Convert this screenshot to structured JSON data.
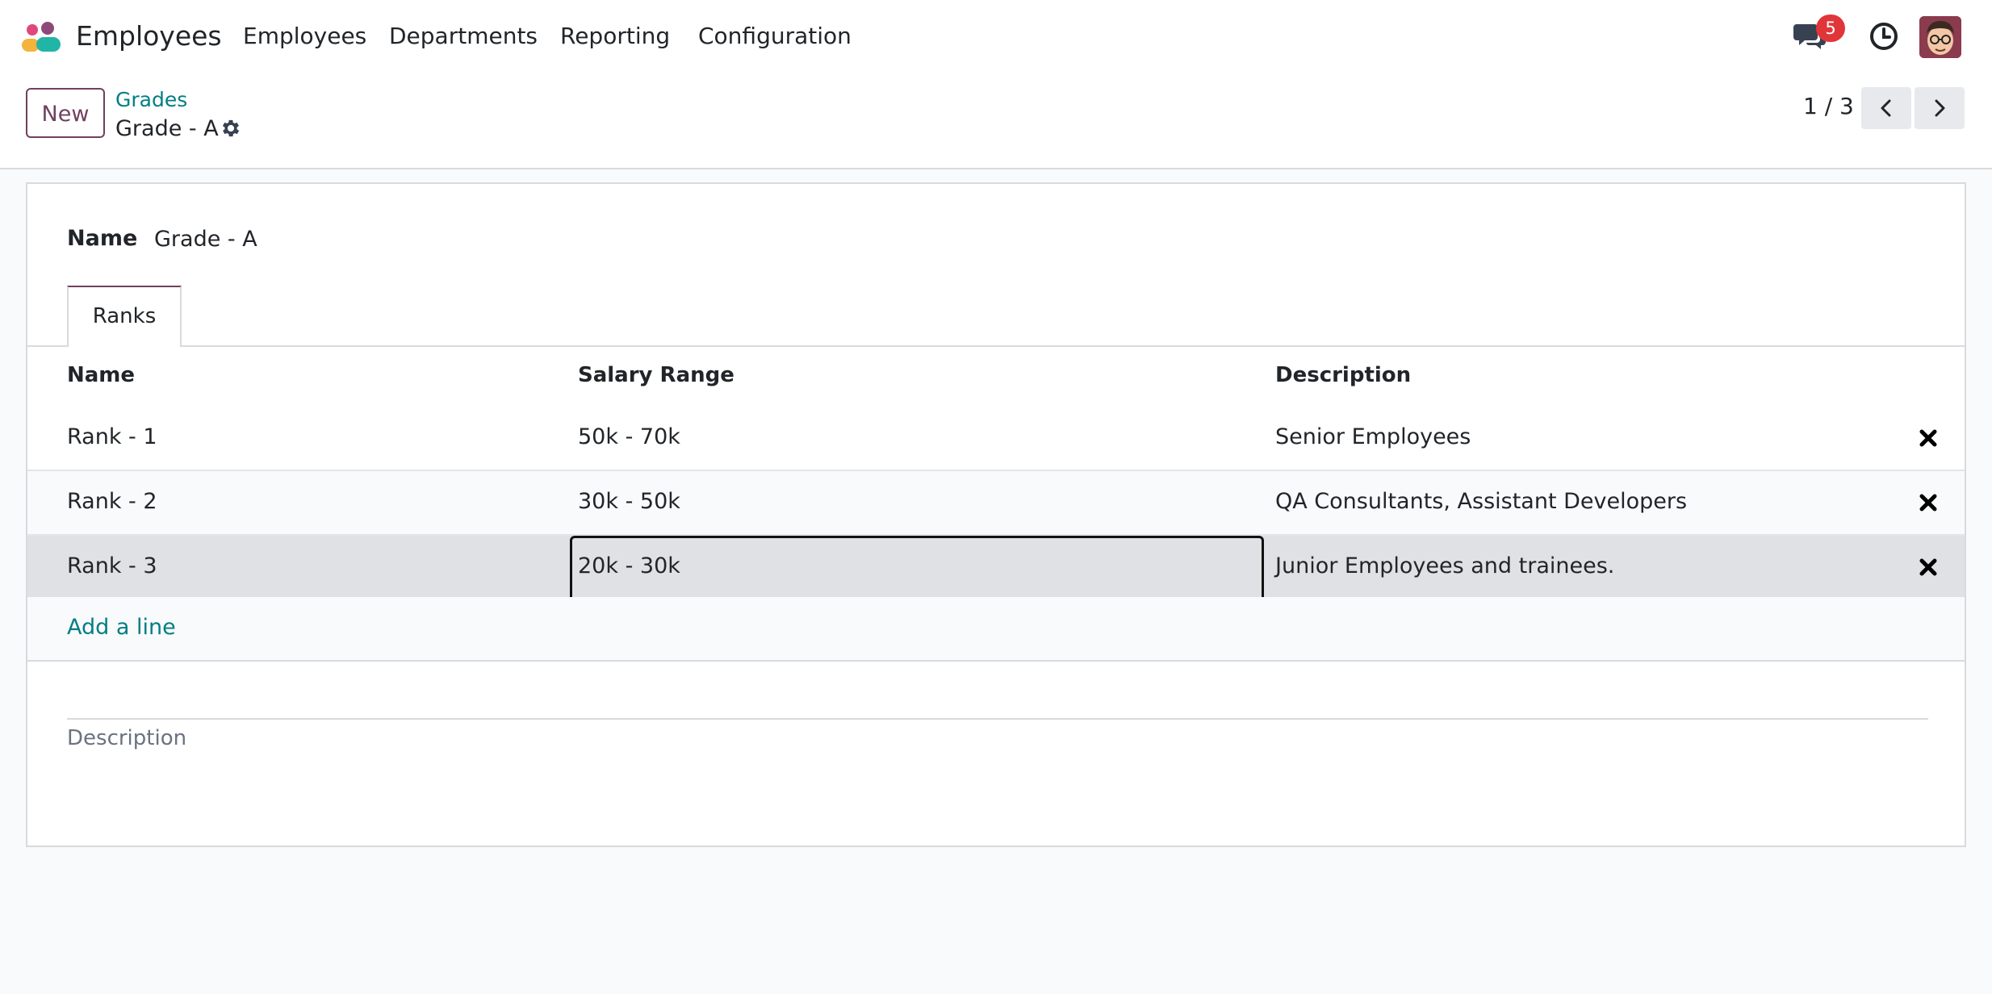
{
  "navbar": {
    "app_name": "Employees",
    "menu": [
      "Employees",
      "Departments",
      "Reporting",
      "Configuration"
    ],
    "messages_badge": "5"
  },
  "control_panel": {
    "new_label": "New",
    "breadcrumb_parent": "Grades",
    "breadcrumb_current": "Grade - A",
    "pager_value": "1 / 3"
  },
  "form": {
    "name_label": "Name",
    "name_value": "Grade - A",
    "tab_label": "Ranks",
    "columns": [
      "Name",
      "Salary Range",
      "Description"
    ],
    "rows": [
      {
        "name": "Rank - 1",
        "salary_range": "50k - 70k",
        "description": "Senior Employees"
      },
      {
        "name": "Rank - 2",
        "salary_range": "30k - 50k",
        "description": "QA Consultants, Assistant Developers"
      },
      {
        "name": "Rank - 3",
        "salary_range": "20k - 30k",
        "description": "Junior Employees and trainees."
      }
    ],
    "add_line_label": "Add a line",
    "description_placeholder": "Description"
  },
  "colors": {
    "brand": "#71405f",
    "link": "#017e84",
    "badge": "#e0363a",
    "selected_row": "#e0e1e4"
  },
  "icons": [
    "app-logo-icon",
    "chat-icon",
    "clock-icon",
    "avatar",
    "gear-icon",
    "chevron-left-icon",
    "chevron-right-icon",
    "delete-icon"
  ]
}
